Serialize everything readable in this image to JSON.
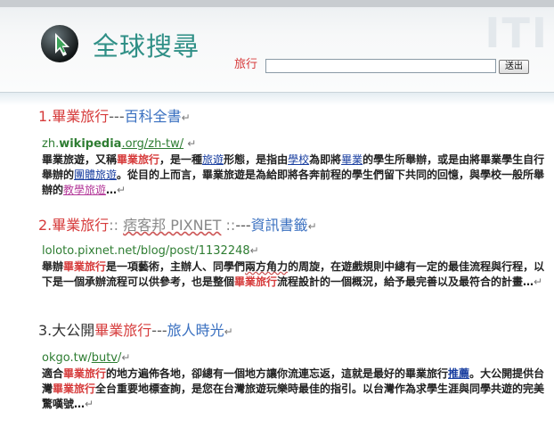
{
  "header": {
    "title": "全球搜尋",
    "decoration": "ITI",
    "search_label": "旅行",
    "search_value": "",
    "search_button": "送出"
  },
  "results": [
    {
      "number": "1.",
      "title_main": "畢業旅行",
      "title_sep": "---",
      "title_source": "百科全書",
      "url_prefix": "zh.",
      "url_domain": "wikipedia",
      "url_suffix": ".org/zh-tw/",
      "snippet": {
        "p1": "畢業旅遊，又稱",
        "h1": "畢業旅行",
        "p2": "，是一種",
        "l1": "旅遊",
        "p3": "形態，是指由",
        "l2": "學校",
        "p4": "為即將",
        "l3": "畢業",
        "p5": "的學生所舉辦，或是由將畢業學生自行舉辦的",
        "l4": "團體旅遊",
        "p6": "。從目的上而言，畢業旅遊是為給即將各奔前程的學生們留下共同的回憶，與學校一般所舉辦的",
        "l5": "教學旅遊",
        "p7": "…"
      }
    },
    {
      "number": "2.",
      "title_main": "畢業旅行",
      "title_mid": ":: ",
      "title_site": "痞客邦 PIXNET",
      "title_mid2": " ::",
      "title_sep": "---",
      "title_source": "資訊書籤",
      "url": "loloto.pixnet.net/blog/post/1132248",
      "snippet": {
        "p1": "舉辦",
        "h1": "畢業旅行",
        "p2": "是一項藝術，主辦人、同學們",
        "w1": "兩方角力",
        "p3": "的周旋，在遊戲規則中總有一定的最佳流程與行程，以下是一個承辦流程可以供參考，也是整個",
        "h2": "畢業旅行",
        "p4": "流程設計的一個概況，給予最完善以及最符合的計畫…"
      }
    },
    {
      "number": "3.",
      "title_pre": "大公開",
      "title_main": "畢業旅行",
      "title_sep": "---",
      "title_source": "旅人時光",
      "url_prefix": "okgo.tw/",
      "url_link": "butv",
      "url_suffix": "/",
      "snippet": {
        "p1": "適合",
        "h1": "畢業旅行",
        "p2": "的地方遍佈各地，卻總有一個地方讓你流連忘返，這就是最好的畢業旅行",
        "b1": "推薦",
        "p3": "。大公開提供台灣",
        "h2": "畢業旅行",
        "p4": "全台重要地標查詢，是您在台灣旅遊玩樂時最佳的指引。以台灣作為求學生涯與同學共遊的完美驚嘆號…"
      }
    }
  ],
  "paragraph_mark": "↵"
}
